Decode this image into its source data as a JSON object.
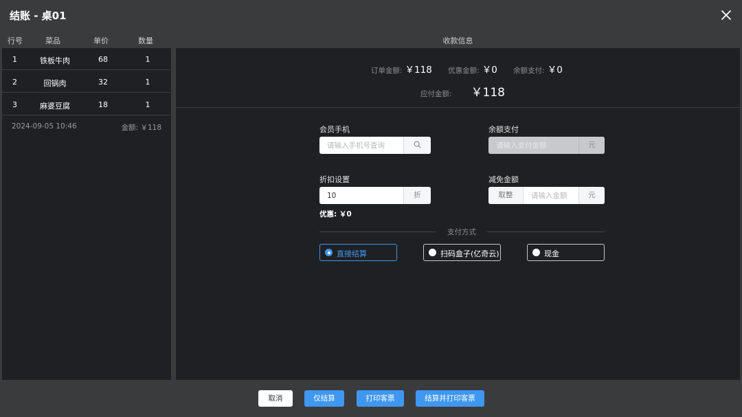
{
  "dialog": {
    "title": "结账 - 桌01"
  },
  "order": {
    "headers": {
      "index": "行号",
      "dish": "菜品",
      "price": "单价",
      "qty": "数量"
    },
    "rows": [
      {
        "index": "1",
        "dish": "铁板牛肉",
        "price": "68",
        "qty": "1"
      },
      {
        "index": "2",
        "dish": "回锅肉",
        "price": "32",
        "qty": "1"
      },
      {
        "index": "3",
        "dish": "麻婆豆腐",
        "price": "18",
        "qty": "1"
      }
    ],
    "time": "2024-09-05 10:46",
    "amount_label": "金额:",
    "amount": "￥118"
  },
  "payment_info": {
    "header": "收款信息",
    "order_amount_label": "订单金额:",
    "order_amount": "￥118",
    "discount_amount_label": "优惠金额:",
    "discount_amount": "￥0",
    "balance_pay_label": "余额支付:",
    "balance_pay": "￥0",
    "payable_label": "应付金额:",
    "payable": "￥118"
  },
  "form": {
    "member_phone_label": "会员手机",
    "member_phone_placeholder": "请输入手机号查询",
    "balance_label": "余额支付",
    "balance_placeholder": "请输入支付金额",
    "balance_unit": "元",
    "discount_label": "折扣设置",
    "discount_value": "10",
    "discount_unit": "折",
    "waive_label": "减免金额",
    "waive_prefix": "取整",
    "waive_placeholder": "请输入金额",
    "waive_unit": "元",
    "discount_result": "优惠: ￥0"
  },
  "pay_methods": {
    "title": "支付方式",
    "options": [
      {
        "label": "直接结算",
        "selected": true
      },
      {
        "label": "扫码盒子(亿奇云)",
        "selected": false
      },
      {
        "label": "现金",
        "selected": false
      }
    ]
  },
  "footer": {
    "cancel": "取消",
    "settle_only": "仅结算",
    "print_receipt": "打印客票",
    "settle_print": "结算并打印客票"
  },
  "colors": {
    "accent": "#3f97ef",
    "panel": "#1f2023",
    "background": "#3a3b3d"
  }
}
